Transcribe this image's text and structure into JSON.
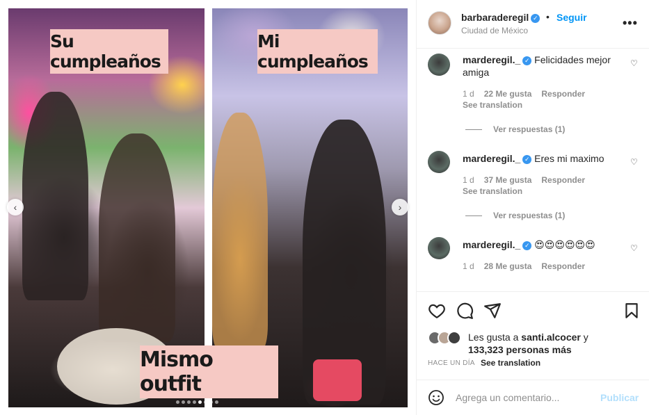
{
  "media": {
    "caption_left": "Su cumpleaños",
    "caption_right": "Mi cumpleaños",
    "caption_bottom": "Mismo outfit",
    "prev_icon": "chevron-left-icon",
    "next_icon": "chevron-right-icon",
    "carousel_slides": 8,
    "carousel_active": 5
  },
  "header": {
    "username": "barbaraderegil",
    "verified": true,
    "separator": "•",
    "follow_label": "Seguir",
    "location": "Ciudad de México",
    "more_label": "•••"
  },
  "comments": [
    {
      "user": "marderegil._",
      "text": "Felicidades mejor amiga",
      "time": "1 d",
      "likes": "22 Me gusta",
      "reply": "Responder",
      "translate": "See translation",
      "replies": "Ver respuestas (1)"
    },
    {
      "user": "marderegil._",
      "text": "Eres mi maximo",
      "time": "1 d",
      "likes": "37 Me gusta",
      "reply": "Responder",
      "translate": "See translation",
      "replies": "Ver respuestas (1)"
    },
    {
      "user": "marderegil._",
      "text": "😍😍😍😍😍😍",
      "time": "1 d",
      "likes": "28 Me gusta",
      "reply": "Responder"
    }
  ],
  "actions": {
    "like_icon": "heart-icon",
    "comment_icon": "comment-icon",
    "share_icon": "paper-plane-icon",
    "save_icon": "bookmark-icon"
  },
  "likes": {
    "prefix": "Les gusta a",
    "user": "santi.alcocer",
    "joiner": "y",
    "count": "133,323 personas más"
  },
  "post_meta": {
    "time_ago": "HACE UN DÍA",
    "see_translation": "See translation"
  },
  "comment_bar": {
    "placeholder": "Agrega un comentario...",
    "publish_label": "Publicar"
  },
  "colors": {
    "accent": "#0095f6",
    "verified": "#3897f0",
    "caption_bg": "#f6c9c4",
    "publish_disabled": "#b2dffc"
  }
}
